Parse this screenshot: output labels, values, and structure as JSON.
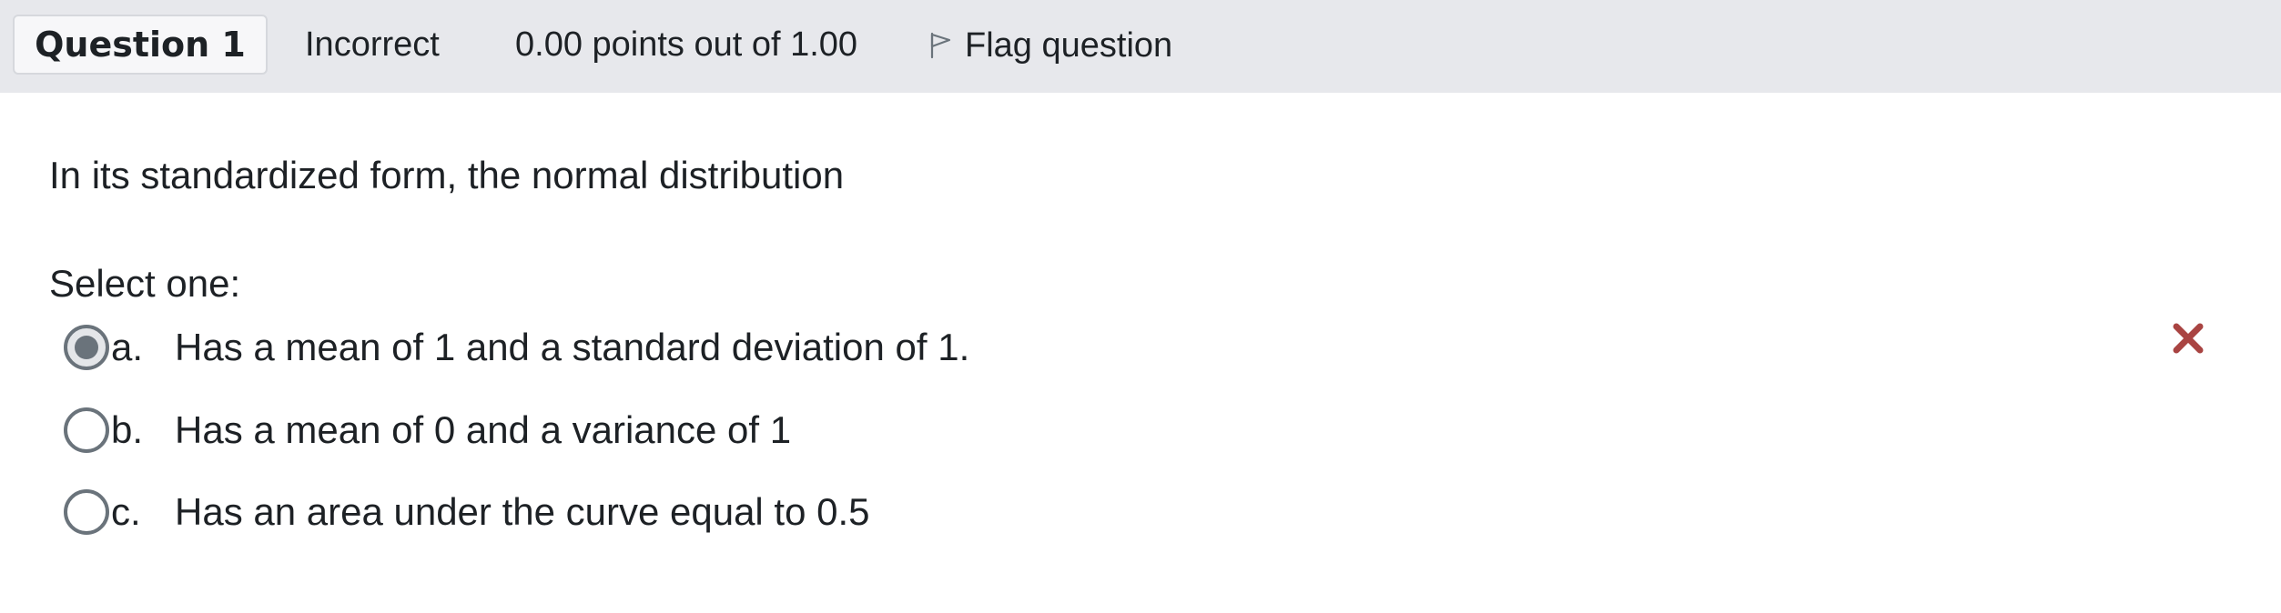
{
  "header": {
    "question_label": "Question 1",
    "status": "Incorrect",
    "grade": "0.00 points out of 1.00",
    "flag_label": "Flag question"
  },
  "question": {
    "text": "In its standardized form, the normal distribution",
    "prompt": "Select one:"
  },
  "answers": [
    {
      "letter": "a.",
      "text": "Has a mean of 1 and a standard deviation of 1.",
      "selected": true
    },
    {
      "letter": "b.",
      "text": "Has a mean of 0 and a variance of 1",
      "selected": false
    },
    {
      "letter": "c.",
      "text": "Has an area under the curve equal to 0.5",
      "selected": false
    }
  ],
  "colors": {
    "header_bg": "#e7e8ec",
    "incorrect_mark": "#a94442",
    "radio": "#6a737b"
  },
  "icons": {
    "flag": "flag-icon",
    "incorrect": "x-mark-icon"
  }
}
